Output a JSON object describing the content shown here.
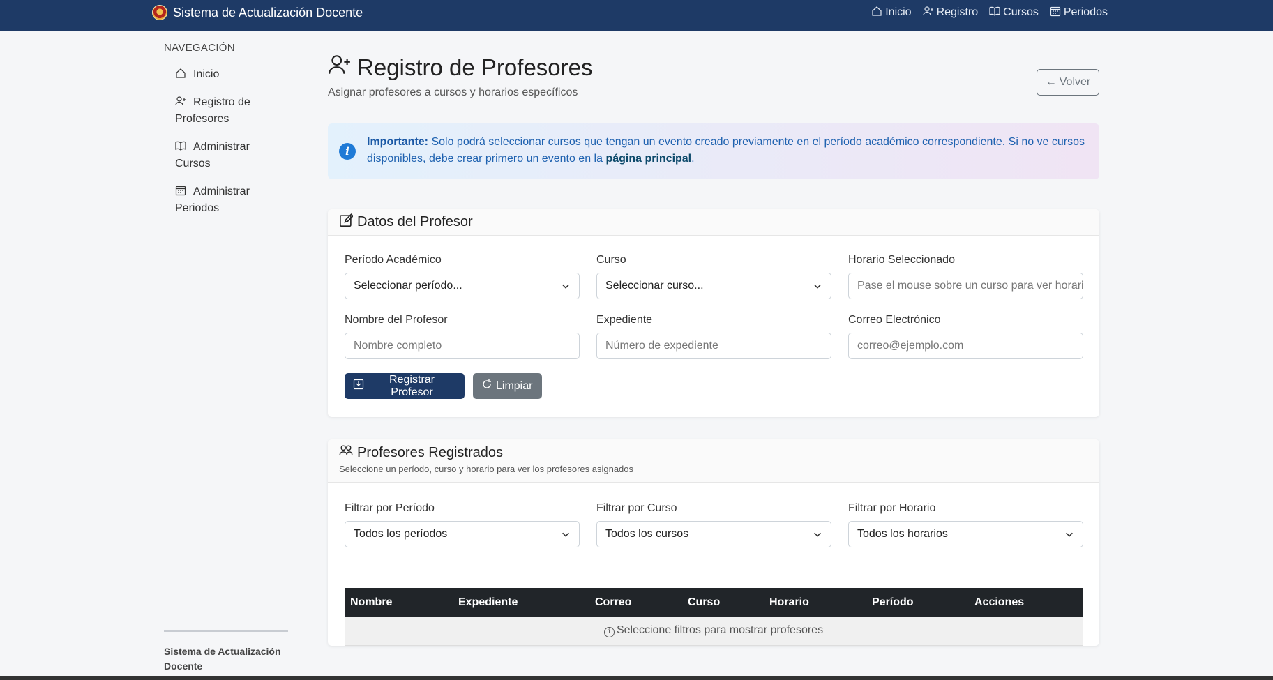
{
  "app": {
    "title": "Sistema de Actualización Docente"
  },
  "topnav": [
    {
      "label": "Inicio",
      "icon": "house-icon"
    },
    {
      "label": "Registro",
      "icon": "person-plus-icon"
    },
    {
      "label": "Cursos",
      "icon": "book-icon"
    },
    {
      "label": "Periodos",
      "icon": "calendar-icon"
    }
  ],
  "sidebar": {
    "title": "NAVEGACIÓN",
    "items": [
      {
        "label": "Inicio",
        "icon": "house-icon"
      },
      {
        "label": "Registro de Profesores",
        "icon": "person-plus-icon"
      },
      {
        "label": "Administrar Cursos",
        "icon": "book-icon"
      },
      {
        "label": "Administrar Periodos",
        "icon": "calendar-icon"
      }
    ],
    "footer": "Sistema de Actualización Docente"
  },
  "page": {
    "title": "Registro de Profesores",
    "subtitle": "Asignar profesores a cursos y horarios específicos",
    "back_label": "Volver"
  },
  "alert": {
    "strong": "Importante:",
    "text": " Solo podrá seleccionar cursos que tengan un evento creado previamente en el período académico correspondiente. Si no ve cursos disponibles, debe crear primero un evento en la ",
    "link": "página principal",
    "end": "."
  },
  "form": {
    "title": "Datos del Profesor",
    "periodo_label": "Período Académico",
    "periodo_value": "Seleccionar período...",
    "curso_label": "Curso",
    "curso_value": "Seleccionar curso...",
    "horario_label": "Horario Seleccionado",
    "horario_placeholder": "Pase el mouse sobre un curso para ver horarios",
    "nombre_label": "Nombre del Profesor",
    "nombre_placeholder": "Nombre completo",
    "expediente_label": "Expediente",
    "expediente_placeholder": "Número de expediente",
    "correo_label": "Correo Electrónico",
    "correo_placeholder": "correo@ejemplo.com",
    "submit_label": "Registrar Profesor",
    "clear_label": "Limpiar"
  },
  "registered": {
    "title": "Profesores Registrados",
    "subtitle": "Seleccione un período, curso y horario para ver los profesores asignados",
    "filter_periodo_label": "Filtrar por Período",
    "filter_periodo_value": "Todos los períodos",
    "filter_curso_label": "Filtrar por Curso",
    "filter_curso_value": "Todos los cursos",
    "filter_horario_label": "Filtrar por Horario",
    "filter_horario_value": "Todos los horarios",
    "columns": [
      "Nombre",
      "Expediente",
      "Correo",
      "Curso",
      "Horario",
      "Período",
      "Acciones"
    ],
    "empty_message": "Seleccione filtros para mostrar profesores"
  }
}
